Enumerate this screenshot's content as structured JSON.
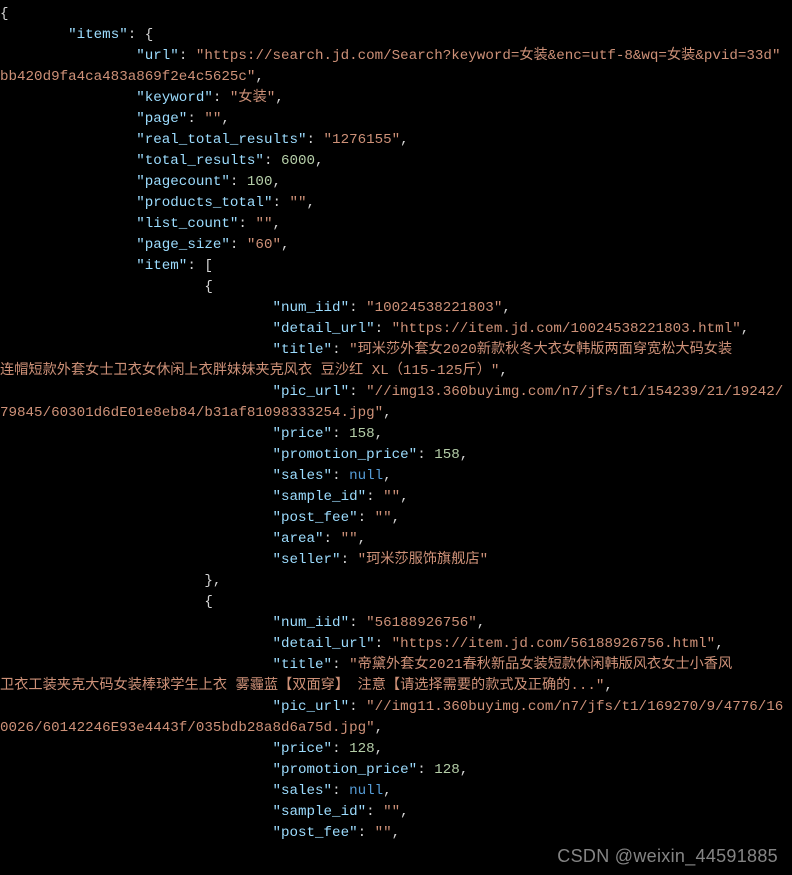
{
  "watermark": "CSDN @weixin_44591885",
  "items": {
    "url": "https://search.jd.com/Search?keyword=女装&enc=utf-8&wq=女装&pvid=33dbb420d9fa4ca483a869f2e4c5625c",
    "keyword": "女装",
    "page": "",
    "real_total_results": "1276155",
    "total_results": 6000,
    "pagecount": 100,
    "products_total": "",
    "list_count": "",
    "page_size": "60",
    "item": [
      {
        "num_iid": "10024538221803",
        "detail_url": "https://item.jd.com/10024538221803.html",
        "title": "珂米莎外套女2020新款秋冬大衣女韩版两面穿宽松大码女装连帽短款外套女士卫衣女休闲上衣胖妹妹夹克风衣 豆沙红 XL（115-125斤）",
        "pic_url": "//img13.360buyimg.com/n7/jfs/t1/154239/21/19242/79845/60301d6dE01e8eb84/b31af81098333254.jpg",
        "price": 158,
        "promotion_price": 158,
        "sales": null,
        "sample_id": "",
        "post_fee": "",
        "area": "",
        "seller": "珂米莎服饰旗舰店"
      },
      {
        "num_iid": "56188926756",
        "detail_url": "https://item.jd.com/56188926756.html",
        "title": "帝黛外套女2021春秋新品女装短款休闲韩版风衣女士小香风卫衣工装夹克大码女装棒球学生上衣 雾霾蓝【双面穿】 注意【请选择需要的款式及正确的...",
        "pic_url": "//img11.360buyimg.com/n7/jfs/t1/169270/9/4776/160026/60142246E93e4443f/035bdb28a8d6a75d.jpg",
        "price": 128,
        "promotion_price": 128,
        "sales": null,
        "sample_id": "",
        "post_fee": ""
      }
    ]
  }
}
